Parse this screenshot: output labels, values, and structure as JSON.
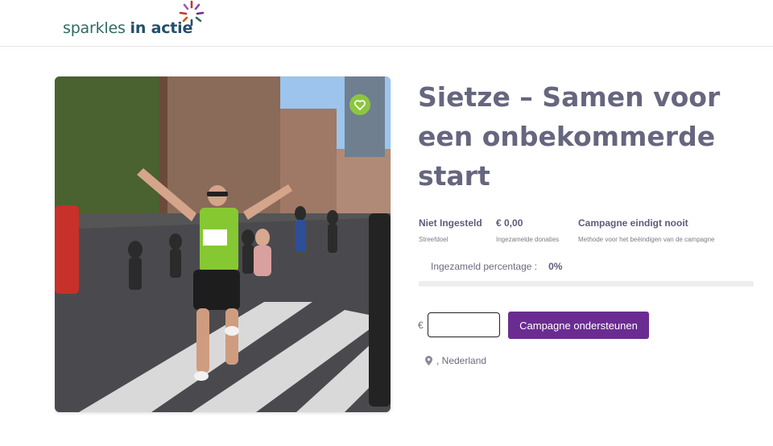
{
  "header": {
    "logo_text_light": "sparkles",
    "logo_text_bold": "in actie",
    "logo_icon": "sparkle-burst-icon"
  },
  "campaign": {
    "title": "Sietze – Samen voor een onbekommerde start",
    "favorite_icon": "heart-icon",
    "stats": {
      "goal_value": "Niet Ingesteld",
      "goal_label": "Streefdoel",
      "raised_value": "€ 0,00",
      "raised_label": "Ingezamelde donaties",
      "end_value": "Campagne eindigt nooit",
      "end_label": "Methode voor het beëindigen van de campagne"
    },
    "percentage_label": "Ingezameld percentage :",
    "percentage_value": "0%",
    "progress_fraction": 0.0,
    "currency_symbol": "€",
    "amount_value": "",
    "support_button": "Campagne ondersteunen",
    "location": ", Nederland",
    "location_icon": "map-pin-icon"
  },
  "colors": {
    "accent_purple": "#6b2c91",
    "heart_green": "#8cc63f",
    "title_gray": "#66667f"
  }
}
